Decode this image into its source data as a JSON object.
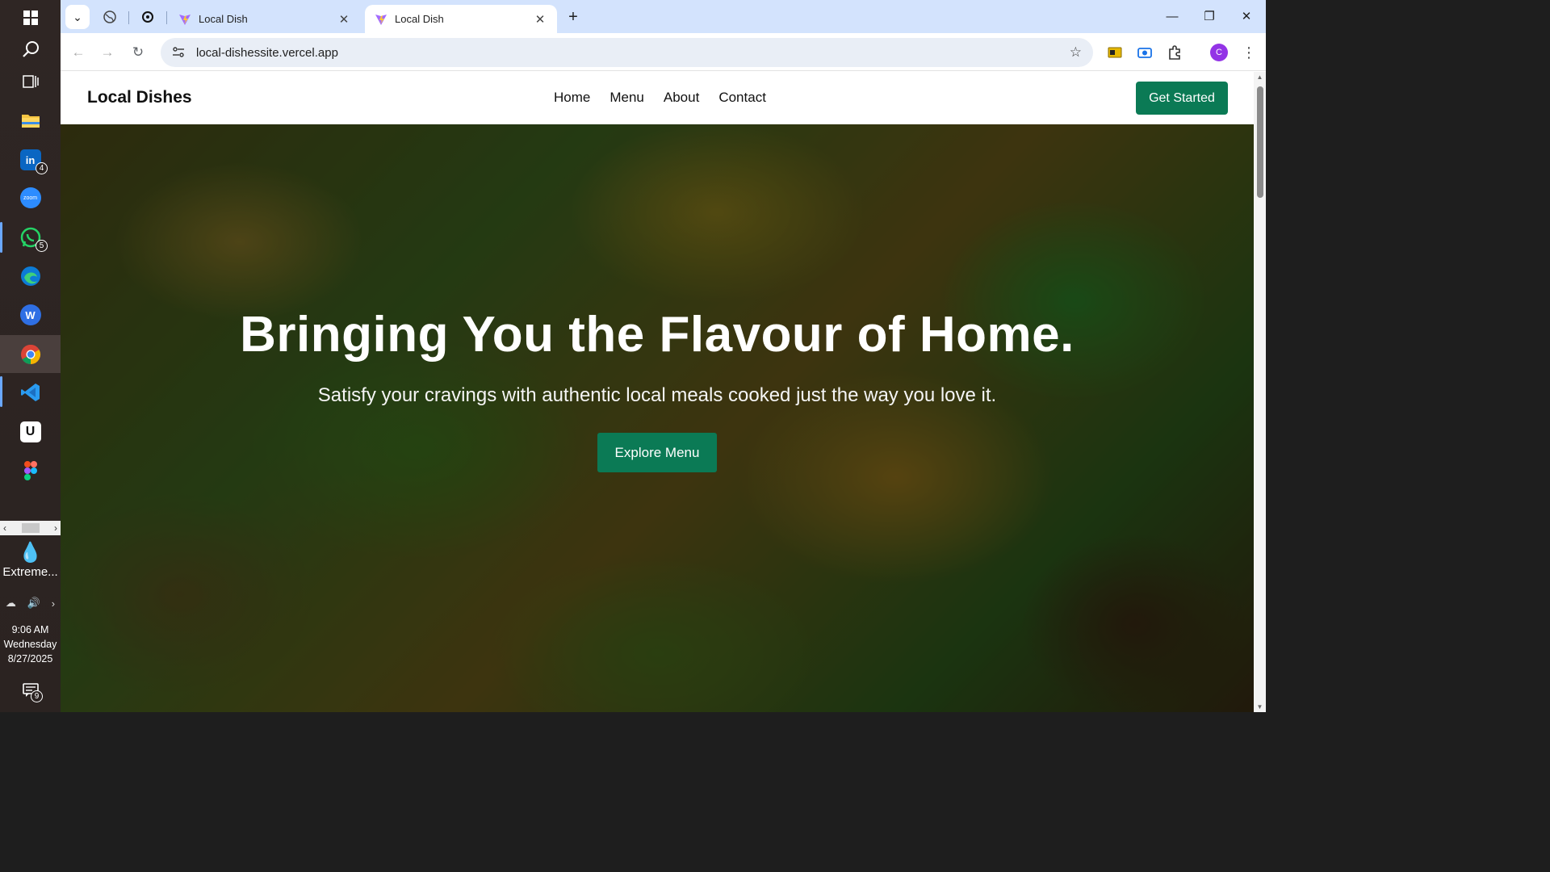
{
  "taskbar": {
    "apps": [
      {
        "name": "windows-start",
        "badge": ""
      },
      {
        "name": "search",
        "badge": ""
      },
      {
        "name": "task-view",
        "badge": ""
      },
      {
        "name": "file-explorer",
        "badge": ""
      },
      {
        "name": "linkedin",
        "badge": "4"
      },
      {
        "name": "zoom",
        "badge": ""
      },
      {
        "name": "whatsapp",
        "badge": "5"
      },
      {
        "name": "edge",
        "badge": ""
      },
      {
        "name": "wps",
        "badge": ""
      },
      {
        "name": "chrome",
        "badge": ""
      },
      {
        "name": "vscode",
        "badge": ""
      },
      {
        "name": "upwork",
        "badge": ""
      },
      {
        "name": "figma",
        "badge": ""
      }
    ],
    "linkedin_badge": "4",
    "whatsapp_badge": "5",
    "zoom_label": "zoom",
    "weather_label": "Extreme...",
    "clock": {
      "time": "9:06 AM",
      "day": "Wednesday",
      "date": "8/27/2025"
    },
    "notifications_badge": "9"
  },
  "browser": {
    "tabs": [
      {
        "title": "Local Dish",
        "active": false
      },
      {
        "title": "Local Dish",
        "active": true
      }
    ],
    "url": "local-dishessite.vercel.app",
    "profile_initial": "C",
    "colors": {
      "tabstrip": "#d3e3fd",
      "omnibox": "#e9eef6",
      "profile": "#9334e6"
    }
  },
  "site": {
    "logo": "Local Dishes",
    "nav": [
      "Home",
      "Menu",
      "About",
      "Contact"
    ],
    "cta": "Get Started",
    "hero": {
      "title": "Bringing You the Flavour of Home.",
      "subtitle": "Satisfy your cravings with authentic local meals cooked just the way you love it.",
      "button": "Explore Menu"
    },
    "colors": {
      "brand_green": "#0b7a55"
    }
  }
}
